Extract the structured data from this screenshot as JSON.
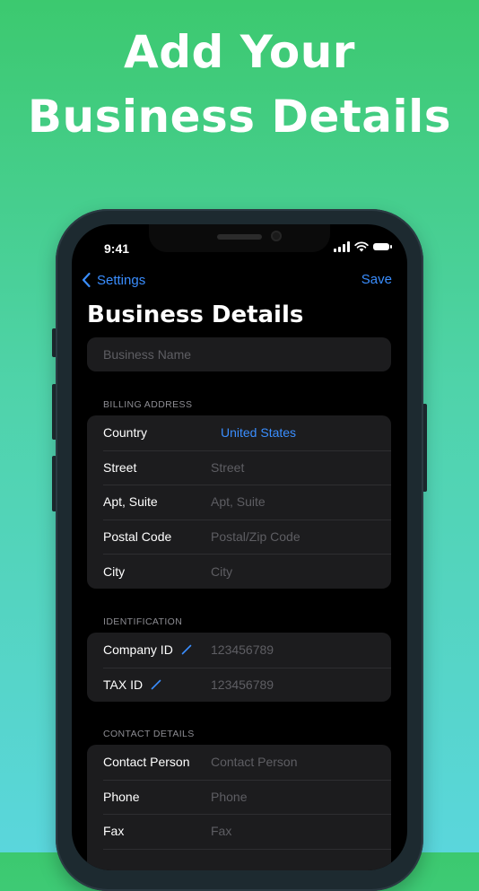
{
  "headline": {
    "line1": "Add Your",
    "line2": "Business Details"
  },
  "status_bar": {
    "time": "9:41"
  },
  "nav": {
    "back_label": "Settings",
    "save_label": "Save"
  },
  "page_title": "Business Details",
  "business_name": {
    "placeholder": "Business Name"
  },
  "billing_address": {
    "header": "BILLING ADDRESS",
    "rows": [
      {
        "label": "Country",
        "value": "United States"
      },
      {
        "label": "Street",
        "placeholder": "Street"
      },
      {
        "label": "Apt, Suite",
        "placeholder": "Apt, Suite"
      },
      {
        "label": "Postal Code",
        "placeholder": "Postal/Zip Code"
      },
      {
        "label": "City",
        "placeholder": "City"
      }
    ]
  },
  "identification": {
    "header": "IDENTIFICATION",
    "rows": [
      {
        "label": "Company ID",
        "placeholder": "123456789",
        "icon": "pencil-icon"
      },
      {
        "label": "TAX ID",
        "placeholder": "123456789",
        "icon": "pencil-icon"
      }
    ]
  },
  "contact_details": {
    "header": "CONTACT DETAILS",
    "rows": [
      {
        "label": "Contact Person",
        "placeholder": "Contact Person"
      },
      {
        "label": "Phone",
        "placeholder": "Phone"
      },
      {
        "label": "Fax",
        "placeholder": "Fax"
      }
    ]
  },
  "colors": {
    "accent": "#3a8eff",
    "background_top": "#3cc96f",
    "background_bottom": "#5ad6dc"
  }
}
